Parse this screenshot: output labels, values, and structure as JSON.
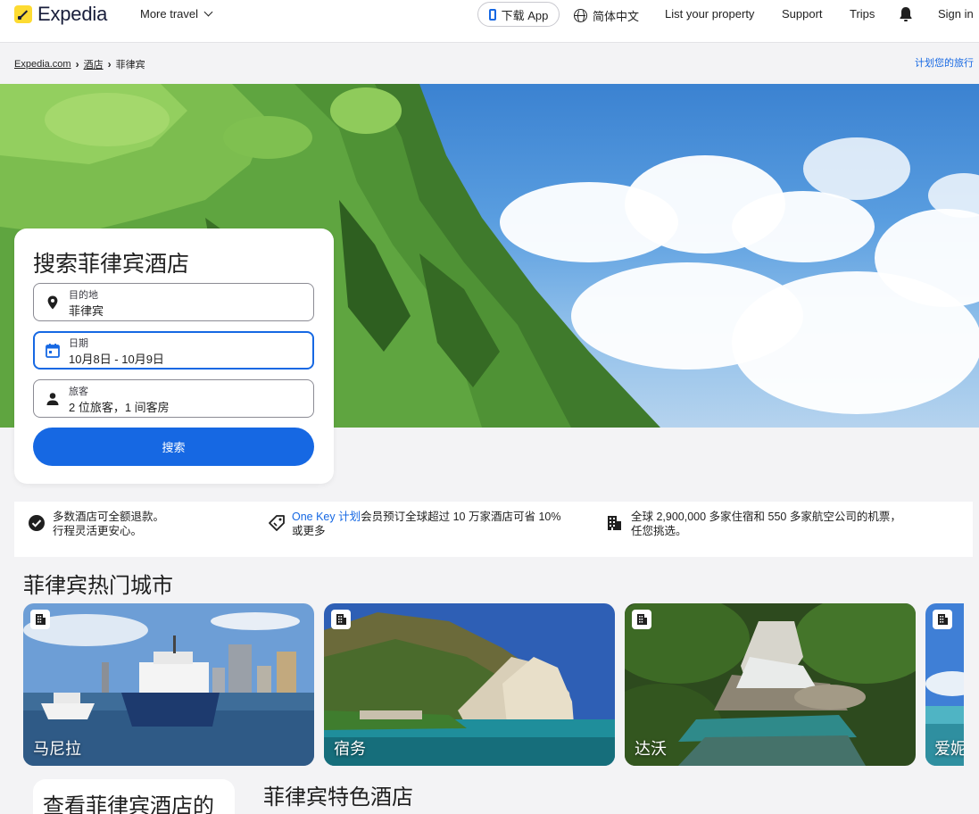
{
  "header": {
    "logo": "Expedia",
    "more_travel": "More travel",
    "download_app": "下载 App",
    "language": "简体中文",
    "list_property": "List your property",
    "support": "Support",
    "trips": "Trips",
    "sign_in": "Sign in"
  },
  "breadcrumb": {
    "items": [
      "Expedia.com",
      "酒店",
      "菲律宾"
    ],
    "plan_trip": "计划您的旅行"
  },
  "search": {
    "title": "搜索菲律宾酒店",
    "destination": {
      "label": "目的地",
      "value": "菲律宾"
    },
    "dates": {
      "label": "日期",
      "value": "10月8日 - 10月9日"
    },
    "travelers": {
      "label": "旅客",
      "value": "2 位旅客，1 间客房"
    },
    "button": "搜索"
  },
  "benefits": [
    {
      "line1": "多数酒店可全额退款。",
      "line2": "行程灵活更安心。"
    },
    {
      "link": "One Key 计划",
      "line1": "会员预订全球超过 10 万家酒店可省 10%",
      "line2": "或更多"
    },
    {
      "line1": "全球 2,900,000 多家住宿和 550 多家航空公司的机票，",
      "line2": "任您挑选。"
    }
  ],
  "cities": {
    "title": "菲律宾热门城市",
    "items": [
      {
        "name": "马尼拉"
      },
      {
        "name": "宿务"
      },
      {
        "name": "达沃"
      },
      {
        "name": "爱妮"
      }
    ]
  },
  "featured": {
    "title": "菲律宾特色酒店",
    "side_card": "查看菲律宾酒店的"
  },
  "colors": {
    "brand_blue": "#1668e3",
    "logo_yellow": "#fddb32",
    "navy": "#191e3b"
  }
}
